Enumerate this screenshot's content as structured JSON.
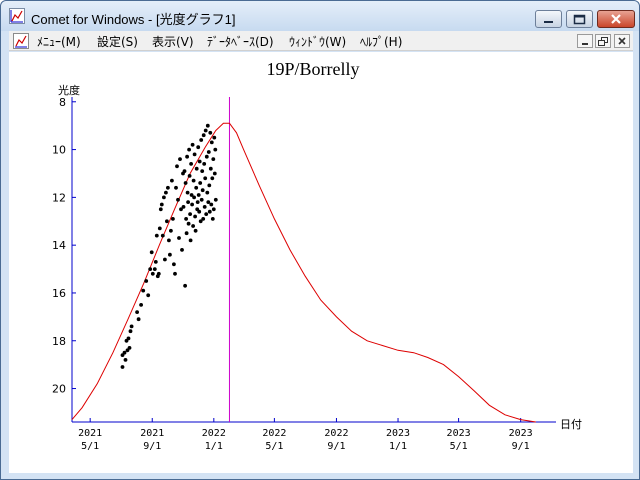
{
  "window": {
    "title": "Comet for Windows - [光度グラフ1]"
  },
  "menu": {
    "items": [
      "ﾒﾆｭｰ(M)",
      "設定(S)",
      "表示(V)",
      "ﾃﾞｰﾀﾍﾞｰｽ(D)",
      "ｳｨﾝﾄﾞｳ(W)",
      "ﾍﾙﾌﾟ(H)"
    ]
  },
  "icons": {
    "app": "chart-icon",
    "minimize": "minimize-icon",
    "maximize": "maximize-icon",
    "close": "close-icon",
    "mdi_restore": "restore-icon"
  },
  "chart_data": {
    "type": "scatter",
    "title": "19P/Borrelly",
    "ylabel": "光度",
    "xlabel": "日付",
    "y_inverted": true,
    "ylim": [
      21.4,
      7.8
    ],
    "xlim": [
      "2021-03-26",
      "2023-11-10"
    ],
    "yticks": [
      8,
      10,
      12,
      14,
      16,
      18,
      20
    ],
    "xticks": [
      {
        "date": "2021-05-01",
        "year": "2021",
        "md": "5/1"
      },
      {
        "date": "2021-09-01",
        "year": "2021",
        "md": "9/1"
      },
      {
        "date": "2022-01-01",
        "year": "2022",
        "md": "1/1"
      },
      {
        "date": "2022-05-01",
        "year": "2022",
        "md": "5/1"
      },
      {
        "date": "2022-09-01",
        "year": "2022",
        "md": "9/1"
      },
      {
        "date": "2023-01-01",
        "year": "2023",
        "md": "1/1"
      },
      {
        "date": "2023-05-01",
        "year": "2023",
        "md": "5/1"
      },
      {
        "date": "2023-09-01",
        "year": "2023",
        "md": "9/1"
      }
    ],
    "current_date_marker": "2022-02-01",
    "colors": {
      "axis": "#0000cc",
      "prediction": "#dd0000",
      "observations": "#000000",
      "marker": "#cc00cc"
    },
    "series": [
      {
        "kind": "prediction-line",
        "points": [
          [
            "2021-03-26",
            21.3
          ],
          [
            "2021-04-15",
            20.8
          ],
          [
            "2021-05-15",
            19.8
          ],
          [
            "2021-06-15",
            18.5
          ],
          [
            "2021-07-15",
            17.1
          ],
          [
            "2021-08-15",
            15.6
          ],
          [
            "2021-09-15",
            14.0
          ],
          [
            "2021-10-15",
            12.5
          ],
          [
            "2021-11-15",
            11.0
          ],
          [
            "2021-12-15",
            9.9
          ],
          [
            "2022-01-05",
            9.2
          ],
          [
            "2022-01-20",
            8.9
          ],
          [
            "2022-02-01",
            8.9
          ],
          [
            "2022-02-15",
            9.3
          ],
          [
            "2022-03-01",
            10.0
          ],
          [
            "2022-04-01",
            11.5
          ],
          [
            "2022-05-01",
            12.9
          ],
          [
            "2022-06-01",
            14.2
          ],
          [
            "2022-07-01",
            15.3
          ],
          [
            "2022-08-01",
            16.3
          ],
          [
            "2022-09-01",
            17.0
          ],
          [
            "2022-10-01",
            17.6
          ],
          [
            "2022-11-01",
            18.0
          ],
          [
            "2022-12-01",
            18.2
          ],
          [
            "2023-01-01",
            18.4
          ],
          [
            "2023-02-01",
            18.5
          ],
          [
            "2023-03-01",
            18.7
          ],
          [
            "2023-04-01",
            19.0
          ],
          [
            "2023-05-01",
            19.5
          ],
          [
            "2023-06-01",
            20.1
          ],
          [
            "2023-07-01",
            20.7
          ],
          [
            "2023-08-01",
            21.1
          ],
          [
            "2023-09-01",
            21.3
          ],
          [
            "2023-10-01",
            21.4
          ]
        ]
      },
      {
        "kind": "observations",
        "points": [
          [
            "2021-07-04",
            18.6
          ],
          [
            "2021-07-04",
            19.1
          ],
          [
            "2021-07-08",
            18.5
          ],
          [
            "2021-07-10",
            18.8
          ],
          [
            "2021-07-12",
            18.0
          ],
          [
            "2021-07-14",
            18.4
          ],
          [
            "2021-07-16",
            17.9
          ],
          [
            "2021-07-18",
            18.3
          ],
          [
            "2021-07-20",
            17.6
          ],
          [
            "2021-07-22",
            17.4
          ],
          [
            "2021-08-02",
            16.8
          ],
          [
            "2021-08-05",
            17.1
          ],
          [
            "2021-08-10",
            16.5
          ],
          [
            "2021-08-14",
            15.9
          ],
          [
            "2021-08-20",
            15.5
          ],
          [
            "2021-08-24",
            16.1
          ],
          [
            "2021-08-28",
            15.0
          ],
          [
            "2021-08-31",
            14.3
          ],
          [
            "2021-09-02",
            15.2
          ],
          [
            "2021-09-06",
            15.0
          ],
          [
            "2021-09-08",
            14.7
          ],
          [
            "2021-09-10",
            13.6
          ],
          [
            "2021-09-12",
            15.3
          ],
          [
            "2021-09-14",
            15.2
          ],
          [
            "2021-09-16",
            13.3
          ],
          [
            "2021-09-18",
            12.5
          ],
          [
            "2021-09-20",
            12.3
          ],
          [
            "2021-09-22",
            13.6
          ],
          [
            "2021-09-24",
            12.0
          ],
          [
            "2021-09-26",
            14.6
          ],
          [
            "2021-09-28",
            11.8
          ],
          [
            "2021-09-30",
            13.0
          ],
          [
            "2021-10-02",
            11.6
          ],
          [
            "2021-10-04",
            13.8
          ],
          [
            "2021-10-06",
            14.4
          ],
          [
            "2021-10-08",
            13.4
          ],
          [
            "2021-10-10",
            11.3
          ],
          [
            "2021-10-12",
            12.9
          ],
          [
            "2021-10-14",
            14.8
          ],
          [
            "2021-10-16",
            15.2
          ],
          [
            "2021-10-18",
            11.6
          ],
          [
            "2021-10-20",
            10.7
          ],
          [
            "2021-10-22",
            12.1
          ],
          [
            "2021-10-24",
            13.7
          ],
          [
            "2021-10-26",
            10.4
          ],
          [
            "2021-10-28",
            12.5
          ],
          [
            "2021-10-30",
            14.2
          ],
          [
            "2021-11-01",
            11.0
          ],
          [
            "2021-11-02",
            12.4
          ],
          [
            "2021-11-04",
            10.9
          ],
          [
            "2021-11-05",
            15.7
          ],
          [
            "2021-11-06",
            11.4
          ],
          [
            "2021-11-07",
            12.9
          ],
          [
            "2021-11-08",
            13.5
          ],
          [
            "2021-11-09",
            10.3
          ],
          [
            "2021-11-10",
            11.8
          ],
          [
            "2021-11-11",
            12.2
          ],
          [
            "2021-11-12",
            13.1
          ],
          [
            "2021-11-13",
            10.0
          ],
          [
            "2021-11-14",
            11.1
          ],
          [
            "2021-11-15",
            12.7
          ],
          [
            "2021-11-16",
            13.8
          ],
          [
            "2021-11-17",
            10.6
          ],
          [
            "2021-11-18",
            11.9
          ],
          [
            "2021-11-19",
            12.3
          ],
          [
            "2021-11-20",
            9.8
          ],
          [
            "2021-11-21",
            13.2
          ],
          [
            "2021-11-22",
            11.3
          ],
          [
            "2021-11-23",
            12.0
          ],
          [
            "2021-11-24",
            10.2
          ],
          [
            "2021-11-25",
            12.8
          ],
          [
            "2021-11-26",
            13.4
          ],
          [
            "2021-11-27",
            11.6
          ],
          [
            "2021-11-28",
            10.8
          ],
          [
            "2021-11-29",
            12.5
          ],
          [
            "2021-11-30",
            12.2
          ],
          [
            "2021-12-01",
            9.9
          ],
          [
            "2021-12-02",
            11.9
          ],
          [
            "2021-12-03",
            12.6
          ],
          [
            "2021-12-04",
            10.5
          ],
          [
            "2021-12-05",
            11.4
          ],
          [
            "2021-12-06",
            13.0
          ],
          [
            "2021-12-07",
            9.6
          ],
          [
            "2021-12-08",
            12.1
          ],
          [
            "2021-12-09",
            10.9
          ],
          [
            "2021-12-10",
            11.7
          ],
          [
            "2021-12-11",
            12.9
          ],
          [
            "2021-12-12",
            9.4
          ],
          [
            "2021-12-13",
            10.6
          ],
          [
            "2021-12-14",
            12.4
          ],
          [
            "2021-12-15",
            11.2
          ],
          [
            "2021-12-16",
            9.2
          ],
          [
            "2021-12-17",
            12.7
          ],
          [
            "2021-12-18",
            10.3
          ],
          [
            "2021-12-19",
            11.8
          ],
          [
            "2021-12-20",
            9.0
          ],
          [
            "2021-12-21",
            12.2
          ],
          [
            "2021-12-22",
            10.1
          ],
          [
            "2021-12-23",
            11.5
          ],
          [
            "2021-12-24",
            12.6
          ],
          [
            "2021-12-25",
            9.3
          ],
          [
            "2021-12-26",
            10.8
          ],
          [
            "2021-12-27",
            12.3
          ],
          [
            "2021-12-28",
            9.7
          ],
          [
            "2021-12-29",
            11.2
          ],
          [
            "2021-12-30",
            12.9
          ],
          [
            "2021-12-31",
            10.4
          ],
          [
            "2022-01-01",
            12.5
          ],
          [
            "2022-01-02",
            9.5
          ],
          [
            "2022-01-03",
            11.0
          ],
          [
            "2022-01-04",
            10.0
          ],
          [
            "2022-01-05",
            12.1
          ]
        ]
      }
    ]
  }
}
